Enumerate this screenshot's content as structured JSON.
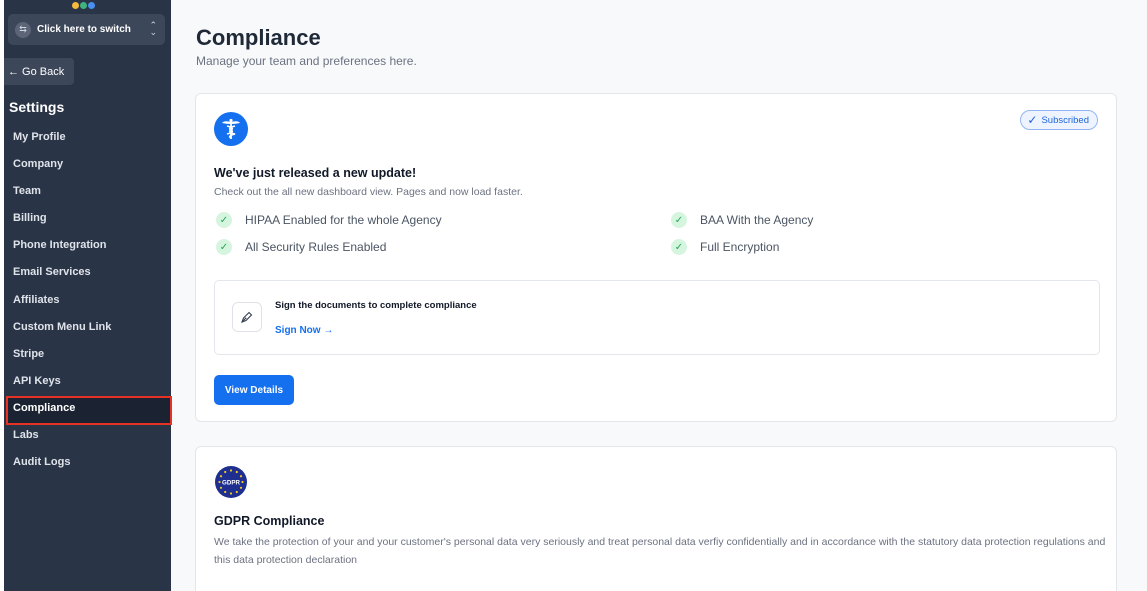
{
  "sidebar": {
    "switch_label": "Click here to switch",
    "go_back": "← Go Back",
    "settings_heading": "Settings",
    "items": [
      {
        "label": "My Profile"
      },
      {
        "label": "Company"
      },
      {
        "label": "Team"
      },
      {
        "label": "Billing"
      },
      {
        "label": "Phone Integration"
      },
      {
        "label": "Email Services"
      },
      {
        "label": "Affiliates"
      },
      {
        "label": "Custom Menu Link"
      },
      {
        "label": "Stripe"
      },
      {
        "label": "API Keys"
      },
      {
        "label": "Compliance",
        "active": true
      },
      {
        "label": "Labs"
      },
      {
        "label": "Audit Logs"
      }
    ]
  },
  "header": {
    "title": "Compliance",
    "subtitle": "Manage your team and preferences here."
  },
  "hipaa_card": {
    "icon": "caduceus-icon",
    "badge": "Subscribed",
    "update_title": "We've just released a new update!",
    "update_subtitle": "Check out the all new dashboard view. Pages and now load faster.",
    "features": [
      "HIPAA Enabled for the whole Agency",
      "BAA With the Agency",
      "All Security Rules Enabled",
      "Full Encryption"
    ],
    "sign_title": "Sign the documents to complete compliance",
    "sign_link": "Sign Now →",
    "view_button": "View Details"
  },
  "gdpr_card": {
    "icon_text": "GDPR",
    "title": "GDPR Compliance",
    "text": "We take the protection of your and your customer's personal data very seriously and treat personal data verfiy confidentially and in accordance with the statutory data protection regulations and this data protection declaration"
  },
  "colors": {
    "sidebar_bg": "#2a3447",
    "accent": "#1570ef",
    "active_outline": "#e53225",
    "success": "#23a455"
  }
}
